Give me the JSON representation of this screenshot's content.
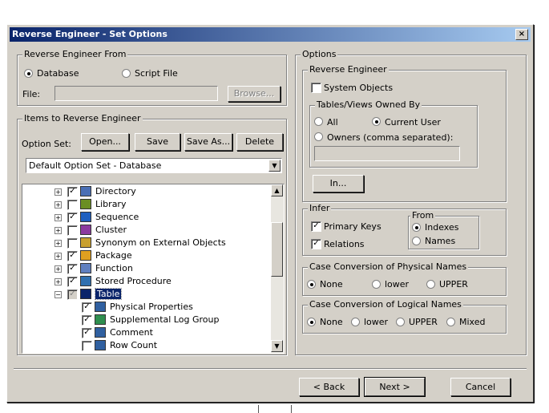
{
  "dialog": {
    "title": "Reverse Engineer - Set Options",
    "close": "×"
  },
  "from": {
    "legend": "Reverse Engineer From",
    "database": "Database",
    "script": "Script File",
    "file_label": "File:",
    "browse": "Browse..."
  },
  "items": {
    "legend": "Items to Reverse Engineer",
    "option_set_label": "Option Set:",
    "open": "Open...",
    "save": "Save",
    "save_as": "Save As...",
    "delete": "Delete",
    "combo_value": "Default Option Set - Database",
    "tree": [
      {
        "label": "Directory",
        "checked": true,
        "icon": "directory-icon",
        "color": "#4a6fb5"
      },
      {
        "label": "Library",
        "checked": false,
        "icon": "library-icon",
        "color": "#6b8e23"
      },
      {
        "label": "Sequence",
        "checked": true,
        "icon": "sequence-icon",
        "color": "#1e5fbf"
      },
      {
        "label": "Cluster",
        "checked": false,
        "icon": "cluster-icon",
        "color": "#8b3a9f"
      },
      {
        "label": "Synonym on External Objects",
        "checked": false,
        "icon": "synonym-icon",
        "color": "#c8a030"
      },
      {
        "label": "Package",
        "checked": true,
        "icon": "package-icon",
        "color": "#e0a020"
      },
      {
        "label": "Function",
        "checked": true,
        "icon": "function-icon",
        "color": "#6080c0"
      },
      {
        "label": "Stored Procedure",
        "checked": true,
        "icon": "stored-procedure-icon",
        "color": "#3070b0"
      },
      {
        "label": "Table",
        "checked": true,
        "icon": "table-icon",
        "color": "#0a246a",
        "selected": true
      },
      {
        "label": "Physical Properties",
        "checked": true,
        "icon": "properties-icon",
        "color": "#3060a0",
        "child": true
      },
      {
        "label": "Supplemental Log Group",
        "checked": true,
        "icon": "log-group-icon",
        "color": "#2f8f4f",
        "child": true
      },
      {
        "label": "Comment",
        "checked": true,
        "icon": "comment-icon",
        "color": "#3060a0",
        "child": true
      },
      {
        "label": "Row Count",
        "checked": false,
        "icon": "row-count-icon",
        "color": "#3060a0",
        "child": true
      }
    ]
  },
  "options": {
    "legend": "Options",
    "re_legend": "Reverse Engineer",
    "system_objects": "System Objects",
    "owned_legend": "Tables/Views Owned By",
    "all": "All",
    "current_user": "Current User",
    "owners": "Owners (comma separated):",
    "in_button": "In...",
    "infer_legend": "Infer",
    "primary_keys": "Primary Keys",
    "relations": "Relations",
    "from_legend": "From",
    "indexes": "Indexes",
    "names": "Names",
    "phys_legend": "Case Conversion of Physical Names",
    "phys_none": "None",
    "phys_lower": "lower",
    "phys_upper": "UPPER",
    "log_legend": "Case Conversion of Logical Names",
    "log_none": "None",
    "log_lower": "lower",
    "log_upper": "UPPER",
    "log_mixed": "Mixed"
  },
  "footer": {
    "back": "< Back",
    "next": "Next >",
    "cancel": "Cancel"
  }
}
